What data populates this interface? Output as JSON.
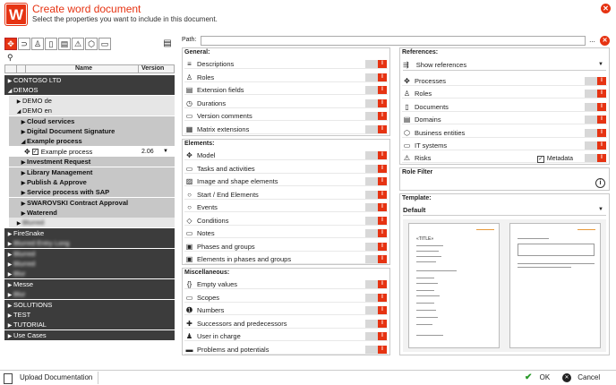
{
  "header": {
    "logo_letter": "W",
    "title": "Create word document",
    "subtitle": "Select the properties you want to include in this document."
  },
  "left": {
    "columns": {
      "name": "Name",
      "version": "Version"
    },
    "tree": [
      {
        "label": "CONTOSO LTD",
        "style": "dark",
        "indent": 0,
        "tri": "▶"
      },
      {
        "label": "DEMOS",
        "style": "dark",
        "indent": 0,
        "tri": "◢"
      },
      {
        "label": "DEMO de",
        "style": "lite",
        "indent": 1,
        "tri": "▶"
      },
      {
        "label": "DEMO en",
        "style": "lite",
        "indent": 1,
        "tri": "◢"
      },
      {
        "label": "Cloud services",
        "style": "gray",
        "indent": 2,
        "tri": "▶"
      },
      {
        "label": "Digital Document Signature",
        "style": "gray",
        "indent": 2,
        "tri": "▶"
      },
      {
        "label": "Example process",
        "style": "gray",
        "indent": 2,
        "tri": "◢"
      },
      {
        "label": "Example process",
        "style": "sel",
        "indent": 3,
        "tri": "",
        "version": "2.06"
      },
      {
        "label": "Investment Request",
        "style": "gray",
        "indent": 2,
        "tri": "▶"
      },
      {
        "label": "Library Management",
        "style": "gray",
        "indent": 2,
        "tri": "▶"
      },
      {
        "label": "Publish & Approve",
        "style": "gray",
        "indent": 2,
        "tri": "▶"
      },
      {
        "label": "Service process with SAP",
        "style": "gray",
        "indent": 2,
        "tri": "▶"
      },
      {
        "label": "SWAROVSKI Contract Approval",
        "style": "gray",
        "indent": 2,
        "tri": "▶"
      },
      {
        "label": "Waterend",
        "style": "gray",
        "indent": 2,
        "tri": "▶"
      },
      {
        "label": "Blurred",
        "style": "lite",
        "indent": 1,
        "tri": "▶",
        "blur": true
      },
      {
        "label": "FireSnake",
        "style": "dark",
        "indent": 0,
        "tri": "▶"
      },
      {
        "label": "Blurred Entry Long",
        "style": "dark",
        "indent": 0,
        "tri": "▶",
        "blur": true
      },
      {
        "label": "Blurred",
        "style": "dark",
        "indent": 0,
        "tri": "▶",
        "blur": true
      },
      {
        "label": "Blurred",
        "style": "dark",
        "indent": 0,
        "tri": "▶",
        "blur": true
      },
      {
        "label": "Blur",
        "style": "dark",
        "indent": 0,
        "tri": "▶",
        "blur": true
      },
      {
        "label": "Messe",
        "style": "dark",
        "indent": 0,
        "tri": "▶"
      },
      {
        "label": "Blur",
        "style": "dark",
        "indent": 0,
        "tri": "▶",
        "blur": true
      },
      {
        "label": "SOLUTIONS",
        "style": "dark",
        "indent": 0,
        "tri": "▶"
      },
      {
        "label": "TEST",
        "style": "dark",
        "indent": 0,
        "tri": "▶"
      },
      {
        "label": "TUTORIAL",
        "style": "dark",
        "indent": 0,
        "tri": "▶"
      },
      {
        "label": "Use Cases",
        "style": "dark",
        "indent": 0,
        "tri": "▶"
      }
    ]
  },
  "path": {
    "label": "Path:",
    "value": "",
    "browse": "..."
  },
  "general": {
    "title": "General:",
    "items": [
      {
        "label": "Descriptions",
        "icon": "≡"
      },
      {
        "label": "Roles",
        "icon": "♙"
      },
      {
        "label": "Extension fields",
        "icon": "▤"
      },
      {
        "label": "Durations",
        "icon": "◷"
      },
      {
        "label": "Version comments",
        "icon": "▭"
      },
      {
        "label": "Matrix extensions",
        "icon": "▦"
      }
    ]
  },
  "elements": {
    "title": "Elements:",
    "items": [
      {
        "label": "Model",
        "icon": "✥"
      },
      {
        "label": "Tasks and activities",
        "icon": "▭"
      },
      {
        "label": "Image and shape elements",
        "icon": "▨"
      },
      {
        "label": "Start / End Elements",
        "icon": "○"
      },
      {
        "label": "Events",
        "icon": "○"
      },
      {
        "label": "Conditions",
        "icon": "◇"
      },
      {
        "label": "Notes",
        "icon": "▭"
      },
      {
        "label": "Phases and groups",
        "icon": "▣"
      },
      {
        "label": "Elements in phases and groups",
        "icon": "▣"
      }
    ]
  },
  "misc": {
    "title": "Miscellaneous:",
    "items": [
      {
        "label": "Empty values",
        "icon": "{}"
      },
      {
        "label": "Scopes",
        "icon": "▭"
      },
      {
        "label": "Numbers",
        "icon": "➊"
      },
      {
        "label": "Successors and predecessors",
        "icon": "✚"
      },
      {
        "label": "User in charge",
        "icon": "♟"
      },
      {
        "label": "Problems and potentials",
        "icon": "▬"
      }
    ]
  },
  "references": {
    "title": "References:",
    "dropdown": "Show references",
    "items": [
      {
        "label": "Processes",
        "icon": "✥"
      },
      {
        "label": "Roles",
        "icon": "♙"
      },
      {
        "label": "Documents",
        "icon": "▯"
      },
      {
        "label": "Domains",
        "icon": "▤"
      },
      {
        "label": "Business entities",
        "icon": "⬡"
      },
      {
        "label": "IT systems",
        "icon": "▭"
      },
      {
        "label": "Risks",
        "icon": "⚠"
      }
    ],
    "metadata_label": "Metadata"
  },
  "role_filter": {
    "title": "Role Filter"
  },
  "template": {
    "title": "Template:",
    "selected": "Default",
    "preview_title": "«TITLE»"
  },
  "footer": {
    "upload": "Upload Documentation",
    "ok": "OK",
    "cancel": "Cancel"
  },
  "toggle_label": "I",
  "colors": {
    "accent": "#e63312"
  }
}
